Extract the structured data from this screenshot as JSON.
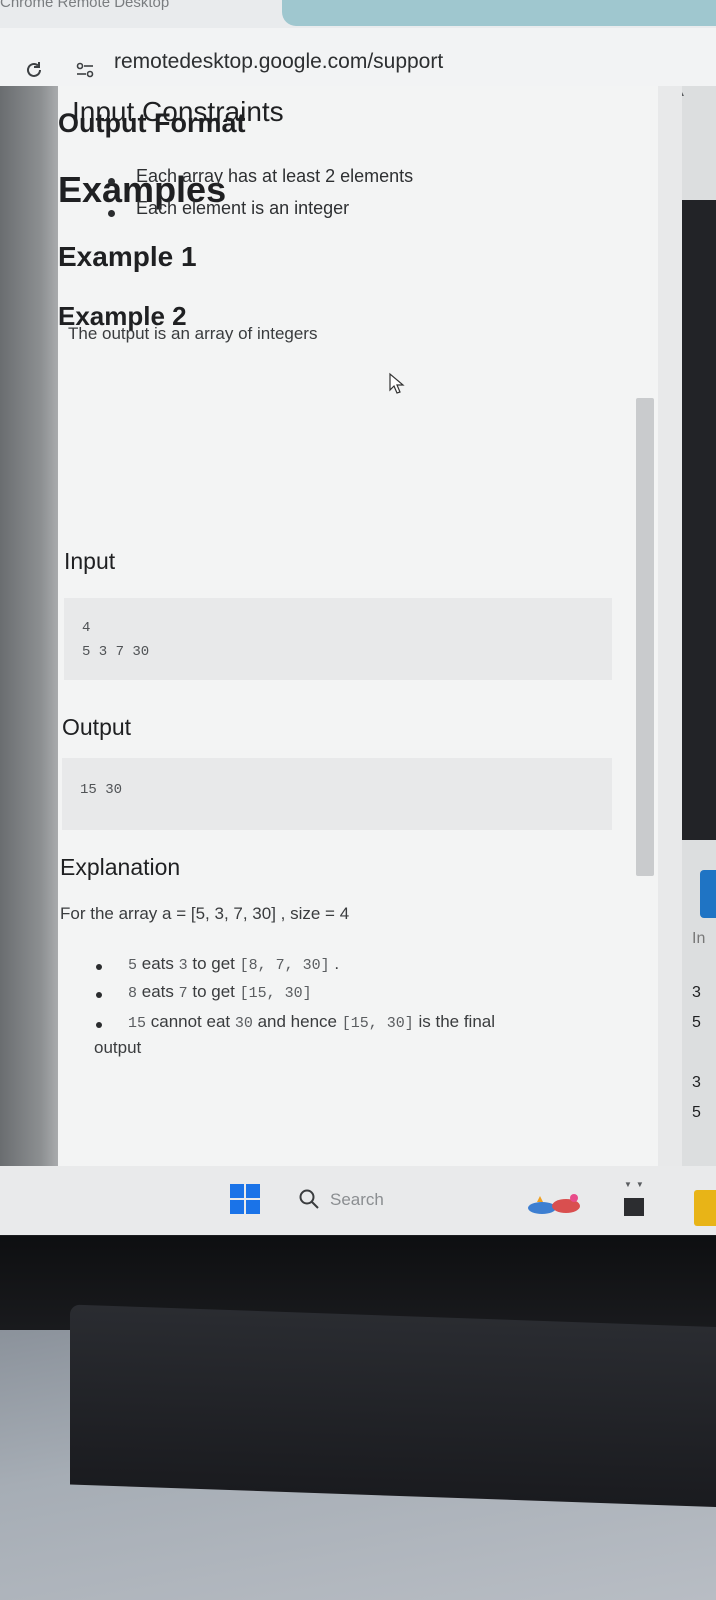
{
  "browser": {
    "app_title": "Chrome Remote Desktop",
    "url": "remotedesktop.google.com/support",
    "reload_icon": "reload-icon",
    "site_info_icon": "site-info-icon"
  },
  "page": {
    "input_constraints": {
      "title": "Input Constraints",
      "items": [
        "Each array has at least 2 elements",
        "Each element is an integer"
      ]
    },
    "output_format": {
      "title": "Output Format",
      "text": "The output is an array of integers"
    },
    "examples_title": "Examples",
    "example1": {
      "title": "Example 1",
      "input_label": "Input",
      "input_lines": [
        "4",
        "5 3 7 30"
      ],
      "output_label": "Output",
      "output_lines": [
        "15 30"
      ],
      "explanation_label": "Explanation",
      "explanation_intro": "For the array a = [5, 3, 7, 30] , size = 4",
      "steps": [
        {
          "a": "5",
          "verb": " eats ",
          "b": "3",
          "mid": " to get ",
          "code": "[8, 7, 30]",
          "tail": " ."
        },
        {
          "a": "8",
          "verb": " eats ",
          "b": "7",
          "mid": " to get ",
          "code": "[15, 30]",
          "tail": ""
        },
        {
          "a": "15",
          "verb": " cannot eat ",
          "b": "30",
          "mid": " and hence ",
          "code": "[15, 30]",
          "tail": " is the final"
        }
      ],
      "steps_wrap": "output"
    },
    "example2": {
      "title": "Example 2"
    }
  },
  "side_peek": {
    "label": "In",
    "values": [
      "3",
      "5",
      "3",
      "5"
    ]
  },
  "taskbar": {
    "search_label": "Search"
  },
  "colors": {
    "page_bg": "#f3f4f4",
    "code_bg": "#e8e9ea",
    "taskbar_bg": "#e9eaeb",
    "start_blue": "#1a73e8"
  }
}
